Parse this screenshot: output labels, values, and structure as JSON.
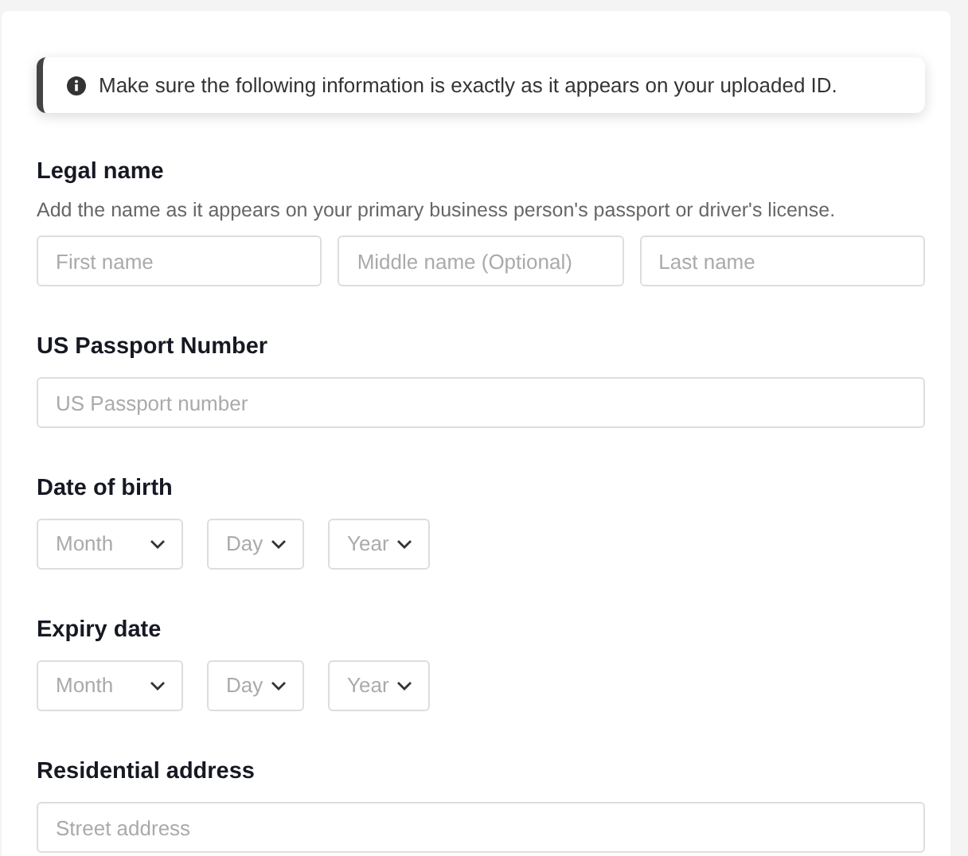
{
  "notice": {
    "text": "Make sure the following information is exactly as it appears on your uploaded ID."
  },
  "sections": [
    {
      "kind": "inputs",
      "label": "Legal name",
      "hint": "Add the name as it appears on your primary business person's passport or driver's license.",
      "fields": [
        {
          "placeholder": "First name"
        },
        {
          "placeholder": "Middle name (Optional)"
        },
        {
          "placeholder": "Last name"
        }
      ]
    },
    {
      "kind": "inputs",
      "label": "US Passport Number",
      "fields": [
        {
          "placeholder": "US Passport number"
        }
      ]
    },
    {
      "kind": "dates",
      "label": "Date of birth",
      "selects": [
        {
          "placeholder": "Month"
        },
        {
          "placeholder": "Day"
        },
        {
          "placeholder": "Year"
        }
      ]
    },
    {
      "kind": "dates",
      "label": "Expiry date",
      "selects": [
        {
          "placeholder": "Month"
        },
        {
          "placeholder": "Day"
        },
        {
          "placeholder": "Year"
        }
      ]
    },
    {
      "kind": "inputs",
      "label": "Residential address",
      "fields": [
        {
          "placeholder": "Street address"
        }
      ]
    }
  ]
}
